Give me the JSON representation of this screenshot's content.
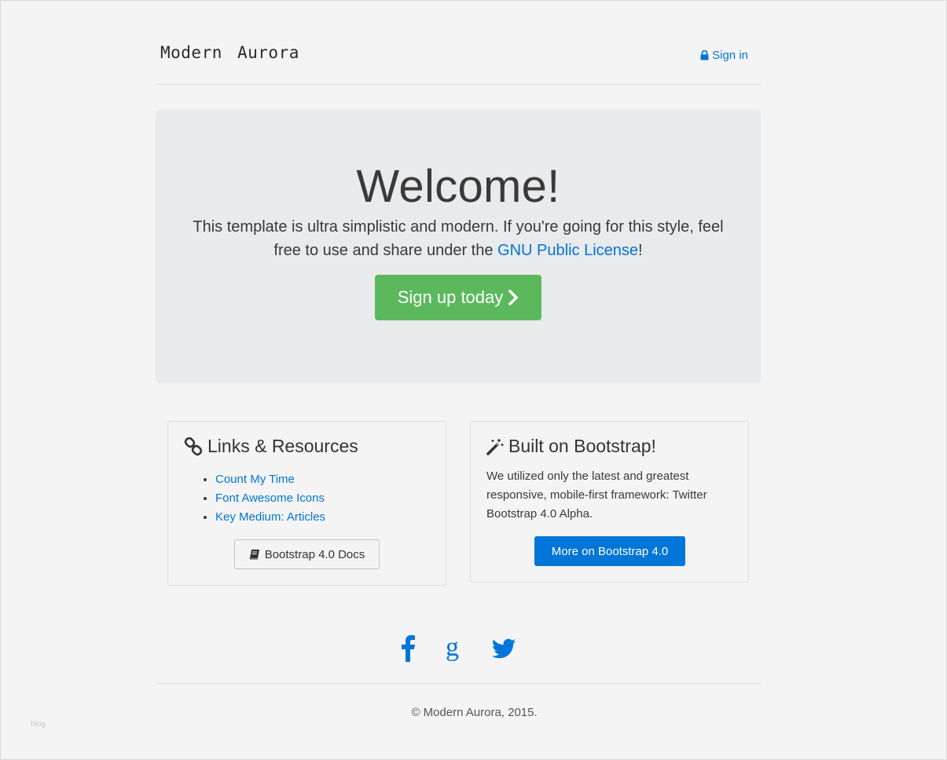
{
  "navbar": {
    "brand": "Modern  Aurora",
    "signin_label": "Sign in"
  },
  "hero": {
    "title": "Welcome!",
    "lead_text": "This template is ultra simplistic and modern. If you're going for this style, feel free to use and share under the ",
    "license_link": "GNU Public License",
    "lead_end": "!",
    "cta_label": "Sign up today"
  },
  "links_card": {
    "title": "Links & Resources",
    "items": [
      {
        "label": "Count My Time"
      },
      {
        "label": "Font Awesome Icons"
      },
      {
        "label": "Key Medium: Articles"
      }
    ],
    "button_label": "Bootstrap 4.0 Docs"
  },
  "bootstrap_card": {
    "title": "Built on Bootstrap!",
    "text": "We utilized only the latest and greatest responsive, mobile-first framework: Twitter Bootstrap 4.0 Alpha.",
    "button_label": "More on Bootstrap 4.0"
  },
  "social": {
    "icons": [
      "facebook-icon",
      "google-icon",
      "twitter-icon"
    ],
    "color": "#0275d8"
  },
  "footer": {
    "copyright": "© Modern Aurora, 2015."
  },
  "watermark": "blog",
  "colors": {
    "primary": "#0275d8",
    "success": "#5cb85c",
    "jumbotron_bg": "#e9eaeb",
    "page_bg": "#f4f4f4"
  }
}
